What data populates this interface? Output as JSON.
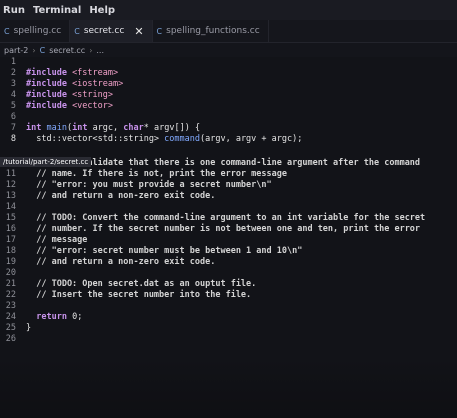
{
  "menubar": {
    "items": [
      "Run",
      "Terminal",
      "Help"
    ]
  },
  "tabs": [
    {
      "label": "spelling.cc",
      "active": false
    },
    {
      "label": "secret.cc",
      "active": true
    },
    {
      "label": "spelling_functions.cc",
      "active": false
    }
  ],
  "breadcrumb": {
    "folder": "part-2",
    "file": "secret.cc",
    "symbol": "..."
  },
  "hover_path": "/tutorial/part-2/secret.cc",
  "editor": {
    "lines": [
      {
        "n": "1",
        "text": ""
      },
      {
        "n": "2",
        "text": "#include <fstream>"
      },
      {
        "n": "3",
        "text": "#include <iostream>"
      },
      {
        "n": "4",
        "text": "#include <string>"
      },
      {
        "n": "5",
        "text": "#include <vector>"
      },
      {
        "n": "6",
        "text": ""
      },
      {
        "n": "7",
        "text": "int main(int argc, char* argv[]) {"
      },
      {
        "n": "8",
        "text": "  std::vector<std::string> command(argv, argv + argc);"
      },
      {
        "n": "10",
        "text": "  // TODO: Validate that there is one command-line argument after the command"
      },
      {
        "n": "11",
        "text": "  // name. If there is not, print the error message"
      },
      {
        "n": "12",
        "text": "  // \"error: you must provide a secret number\\n\""
      },
      {
        "n": "13",
        "text": "  // and return a non-zero exit code."
      },
      {
        "n": "14",
        "text": ""
      },
      {
        "n": "15",
        "text": "  // TODO: Convert the command-line argument to an int variable for the secret"
      },
      {
        "n": "16",
        "text": "  // number. If the secret number is not between one and ten, print the error"
      },
      {
        "n": "17",
        "text": "  // message"
      },
      {
        "n": "18",
        "text": "  // \"error: secret number must be between 1 and 10\\n\""
      },
      {
        "n": "19",
        "text": "  // and return a non-zero exit code."
      },
      {
        "n": "20",
        "text": ""
      },
      {
        "n": "21",
        "text": "  // TODO: Open secret.dat as an ouptut file."
      },
      {
        "n": "22",
        "text": "  // Insert the secret number into the file."
      },
      {
        "n": "23",
        "text": ""
      },
      {
        "n": "24",
        "text": "  return 0;"
      },
      {
        "n": "25",
        "text": "}"
      },
      {
        "n": "26",
        "text": ""
      }
    ]
  },
  "colors": {
    "background": "#121318",
    "comment": "#d4d4d4",
    "keyword": "#c792ea",
    "string": "#f0a0c8"
  }
}
